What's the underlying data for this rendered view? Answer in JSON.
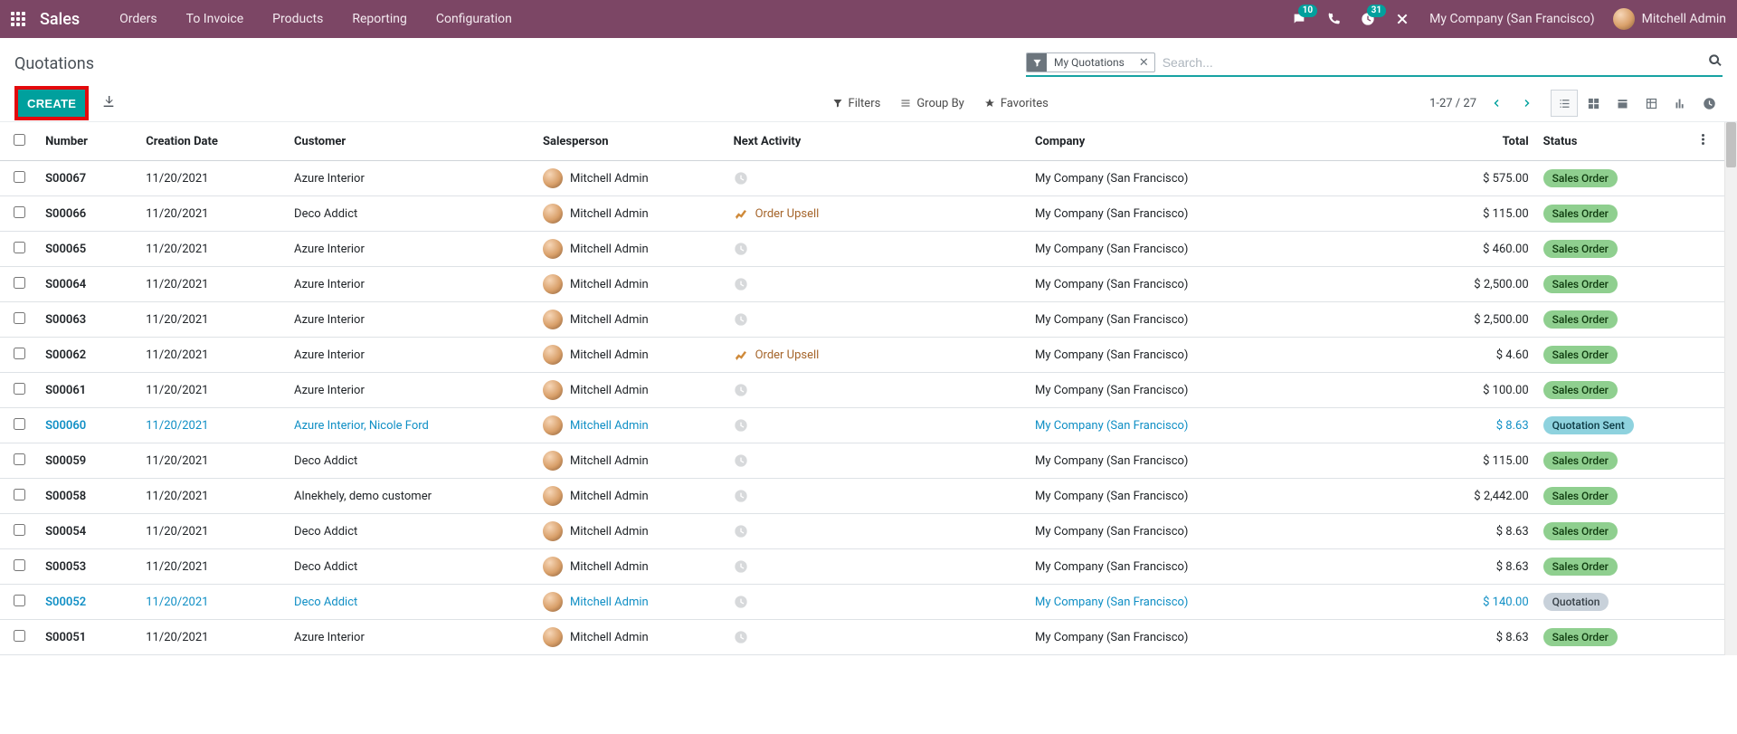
{
  "nav": {
    "app": "Sales",
    "menus": [
      "Orders",
      "To Invoice",
      "Products",
      "Reporting",
      "Configuration"
    ],
    "chat_badge": "10",
    "activity_badge": "31",
    "company": "My Company (San Francisco)",
    "user": "Mitchell Admin"
  },
  "cp": {
    "breadcrumb": "Quotations",
    "create": "CREATE",
    "search_chip": "My Quotations",
    "search_placeholder": "Search...",
    "filters": "Filters",
    "groupby": "Group By",
    "favorites": "Favorites",
    "pager": "1-27 / 27"
  },
  "columns": {
    "number": "Number",
    "date": "Creation Date",
    "customer": "Customer",
    "salesperson": "Salesperson",
    "activity": "Next Activity",
    "company": "Company",
    "total": "Total",
    "status": "Status"
  },
  "rows": [
    {
      "num": "S00067",
      "date": "11/20/2021",
      "cust": "Azure Interior",
      "sp": "Mitchell Admin",
      "act": "",
      "co": "My Company (San Francisco)",
      "total": "$ 575.00",
      "status": "Sales Order",
      "st": "so",
      "link": false
    },
    {
      "num": "S00066",
      "date": "11/20/2021",
      "cust": "Deco Addict",
      "sp": "Mitchell Admin",
      "act": "Order Upsell",
      "co": "My Company (San Francisco)",
      "total": "$ 115.00",
      "status": "Sales Order",
      "st": "so",
      "link": false
    },
    {
      "num": "S00065",
      "date": "11/20/2021",
      "cust": "Azure Interior",
      "sp": "Mitchell Admin",
      "act": "",
      "co": "My Company (San Francisco)",
      "total": "$ 460.00",
      "status": "Sales Order",
      "st": "so",
      "link": false
    },
    {
      "num": "S00064",
      "date": "11/20/2021",
      "cust": "Azure Interior",
      "sp": "Mitchell Admin",
      "act": "",
      "co": "My Company (San Francisco)",
      "total": "$ 2,500.00",
      "status": "Sales Order",
      "st": "so",
      "link": false
    },
    {
      "num": "S00063",
      "date": "11/20/2021",
      "cust": "Azure Interior",
      "sp": "Mitchell Admin",
      "act": "",
      "co": "My Company (San Francisco)",
      "total": "$ 2,500.00",
      "status": "Sales Order",
      "st": "so",
      "link": false
    },
    {
      "num": "S00062",
      "date": "11/20/2021",
      "cust": "Azure Interior",
      "sp": "Mitchell Admin",
      "act": "Order Upsell",
      "co": "My Company (San Francisco)",
      "total": "$ 4.60",
      "status": "Sales Order",
      "st": "so",
      "link": false
    },
    {
      "num": "S00061",
      "date": "11/20/2021",
      "cust": "Azure Interior",
      "sp": "Mitchell Admin",
      "act": "",
      "co": "My Company (San Francisco)",
      "total": "$ 100.00",
      "status": "Sales Order",
      "st": "so",
      "link": false
    },
    {
      "num": "S00060",
      "date": "11/20/2021",
      "cust": "Azure Interior, Nicole Ford",
      "sp": "Mitchell Admin",
      "act": "",
      "co": "My Company (San Francisco)",
      "total": "$ 8.63",
      "status": "Quotation Sent",
      "st": "qs",
      "link": true
    },
    {
      "num": "S00059",
      "date": "11/20/2021",
      "cust": "Deco Addict",
      "sp": "Mitchell Admin",
      "act": "",
      "co": "My Company (San Francisco)",
      "total": "$ 115.00",
      "status": "Sales Order",
      "st": "so",
      "link": false
    },
    {
      "num": "S00058",
      "date": "11/20/2021",
      "cust": "Alnekhely, demo customer",
      "sp": "Mitchell Admin",
      "act": "",
      "co": "My Company (San Francisco)",
      "total": "$ 2,442.00",
      "status": "Sales Order",
      "st": "so",
      "link": false
    },
    {
      "num": "S00054",
      "date": "11/20/2021",
      "cust": "Deco Addict",
      "sp": "Mitchell Admin",
      "act": "",
      "co": "My Company (San Francisco)",
      "total": "$ 8.63",
      "status": "Sales Order",
      "st": "so",
      "link": false
    },
    {
      "num": "S00053",
      "date": "11/20/2021",
      "cust": "Deco Addict",
      "sp": "Mitchell Admin",
      "act": "",
      "co": "My Company (San Francisco)",
      "total": "$ 8.63",
      "status": "Sales Order",
      "st": "so",
      "link": false
    },
    {
      "num": "S00052",
      "date": "11/20/2021",
      "cust": "Deco Addict",
      "sp": "Mitchell Admin",
      "act": "",
      "co": "My Company (San Francisco)",
      "total": "$ 140.00",
      "status": "Quotation",
      "st": "q",
      "link": true
    },
    {
      "num": "S00051",
      "date": "11/20/2021",
      "cust": "Azure Interior",
      "sp": "Mitchell Admin",
      "act": "",
      "co": "My Company (San Francisco)",
      "total": "$ 8.63",
      "status": "Sales Order",
      "st": "so",
      "link": false
    }
  ]
}
